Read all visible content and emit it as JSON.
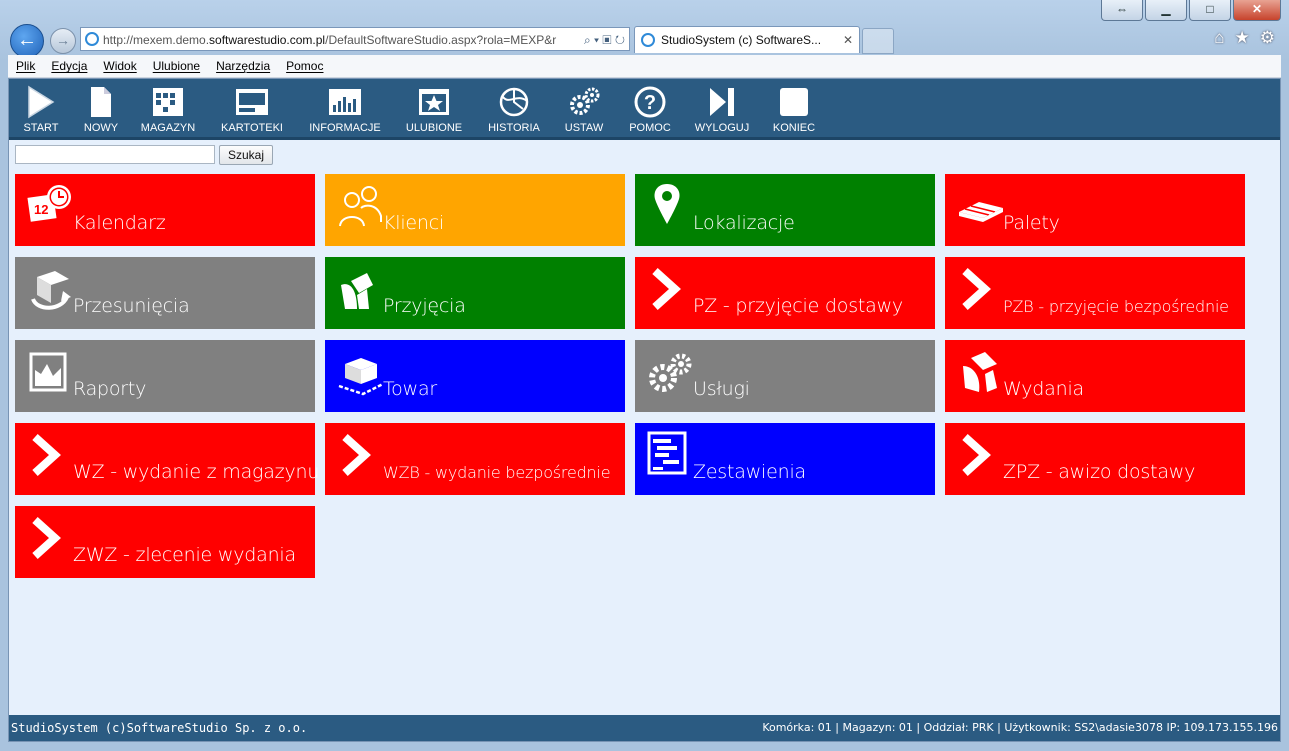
{
  "browser": {
    "address_prefix": "http://mexem.demo.",
    "address_domain": "softwarestudio.com.pl",
    "address_suffix": "/DefaultSoftwareStudio.aspx?rola=MEXP&r",
    "tab_title": "StudioSystem (c) SoftwareS...",
    "menu": [
      "Plik",
      "Edycja",
      "Widok",
      "Ulubione",
      "Narzędzia",
      "Pomoc"
    ]
  },
  "toolbar": {
    "start": "START",
    "nowy": "NOWY",
    "magazyn": "MAGAZYN",
    "kartoteki": "KARTOTEKI",
    "informacje": "INFORMACJE",
    "ulubione": "ULUBIONE",
    "historia": "HISTORIA",
    "ustaw": "USTAW",
    "pomoc": "POMOC",
    "wyloguj": "WYLOGUJ",
    "koniec": "KONIEC"
  },
  "search": {
    "value": "",
    "button": "Szukaj"
  },
  "tiles": {
    "kalendarz": "Kalendarz",
    "klienci": "Klienci",
    "lokalizacje": "Lokalizacje",
    "palety": "Palety",
    "przesuniecia": "Przesunięcia",
    "przyjecia": "Przyjęcia",
    "pz": "PZ - przyjęcie dostawy",
    "pzb": "PZB - przyjęcie bezpośrednie",
    "raporty": "Raporty",
    "towar": "Towar",
    "uslugi": "Usługi",
    "wydania": "Wydania",
    "wz": "WZ - wydanie z magazynu",
    "wzb": "WZB - wydanie bezpośrednie",
    "zestawienia": "Zestawienia",
    "zpz": "ZPZ - awizo dostawy",
    "zwz": "ZWZ - zlecenie wydania"
  },
  "colors": {
    "red": "#ff0000",
    "orange": "#ffa500",
    "green": "#008000",
    "gray": "#808080",
    "blue": "#0000ff",
    "toolbar": "#2b5b82"
  },
  "status": {
    "left": "StudioSystem (c)SoftwareStudio Sp. z o.o.",
    "right": "Komórka: 01 | Magazyn: 01 | Oddział: PRK | Użytkownik: SS2\\adasie3078 IP: 109.173.155.196"
  }
}
